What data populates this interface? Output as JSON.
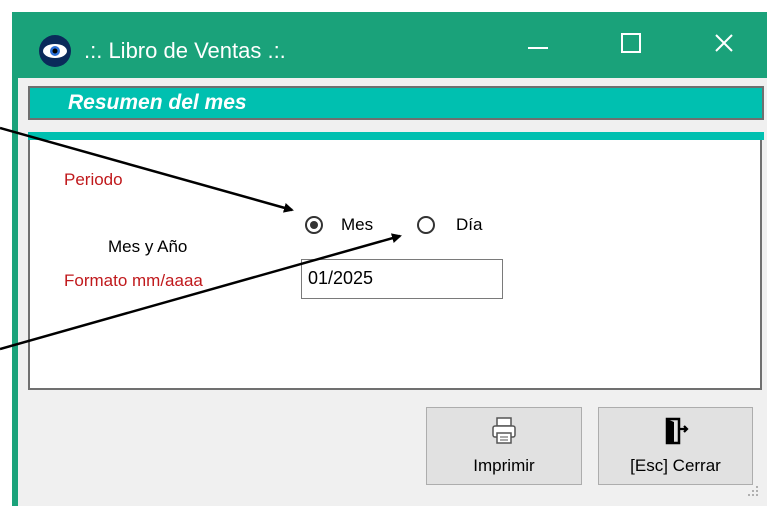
{
  "window": {
    "title": ".:. Libro de Ventas .:.",
    "accent_color": "#1aa27a",
    "controls": {
      "minimize": "minimize-icon",
      "maximize": "maximize-icon",
      "close": "close-icon"
    }
  },
  "header": {
    "title": "Resumen del mes",
    "color": "#00c0b0"
  },
  "form": {
    "period_label": "Periodo",
    "radio_options": [
      {
        "label": "Mes",
        "selected": true
      },
      {
        "label": "Día",
        "selected": false
      }
    ],
    "date_label": "Mes y Año",
    "format_label": "Formato mm/aaaa",
    "date_value": "01/2025"
  },
  "buttons": {
    "print_label": "Imprimir",
    "print_icon": "printer-icon",
    "close_label": "[Esc] Cerrar",
    "close_icon": "exit-door-icon"
  }
}
